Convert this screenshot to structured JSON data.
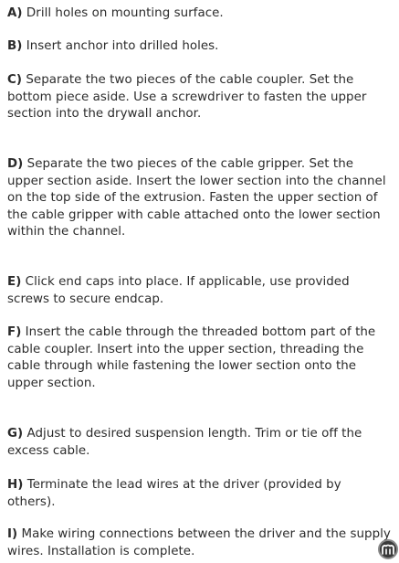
{
  "steps": [
    {
      "letter": "A)",
      "text": " Drill holes on mounting surface."
    },
    {
      "letter": "B)",
      "text": " Insert anchor into drilled holes."
    },
    {
      "letter": "C)",
      "text": " Separate the two pieces of the cable coupler. Set the bottom piece aside. Use a screwdriver to fasten the upper section into the drywall anchor."
    },
    {
      "letter": "D)",
      "text": " Separate the two pieces of the cable gripper. Set the upper section aside. Insert the lower section into the channel on the top side of the extrusion. Fasten the upper section of the cable gripper with cable attached onto the lower section within the channel."
    },
    {
      "letter": "E)",
      "text": " Click end caps into place. If applicable, use provided screws to secure endcap."
    },
    {
      "letter": "F)",
      "text": " Insert the cable through the threaded bottom part of the cable coupler. Insert into the upper section, threading the cable through while fastening the lower section onto the upper section."
    },
    {
      "letter": "G)",
      "text": " Adjust to desired suspension length. Trim or tie off the excess cable."
    },
    {
      "letter": "H)",
      "text": " Terminate the lead wires at the driver (provided by others)."
    },
    {
      "letter": "I)",
      "text": " Make wiring connections between the driver and the supply wires. Installation is complete."
    }
  ],
  "badge_icon": "brand-logo-icon"
}
